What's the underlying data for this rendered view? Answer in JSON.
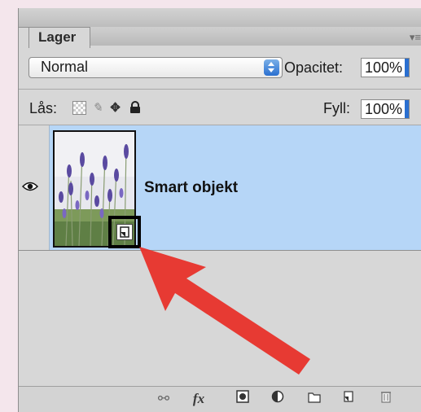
{
  "panel": {
    "tab_title": "Lager",
    "menu_icon": "panel-menu-icon"
  },
  "blend": {
    "mode": "Normal",
    "opacity_label": "Opacitet:",
    "opacity_value": "100%"
  },
  "lock": {
    "label": "Lås:",
    "fill_label": "Fyll:",
    "fill_value": "100%",
    "icons": [
      "transparency-lock-icon",
      "brush-lock-icon",
      "move-lock-icon",
      "padlock-icon"
    ]
  },
  "layers": [
    {
      "name": "Smart objekt",
      "visible": true,
      "selected": true,
      "thumbnail": "lavender-photo",
      "badge_icon": "smart-object-icon"
    }
  ],
  "bottom_bar": {
    "icons": [
      "link-icon",
      "fx-icon",
      "mask-icon",
      "adjustment-icon",
      "folder-icon",
      "new-layer-icon",
      "trash-icon"
    ],
    "fx_label": "fx"
  },
  "colors": {
    "selection": "#b6d6f7",
    "panel_bg": "#d7d7d7",
    "arrow": "#e8312a",
    "page_bg": "#f4e6ec"
  }
}
